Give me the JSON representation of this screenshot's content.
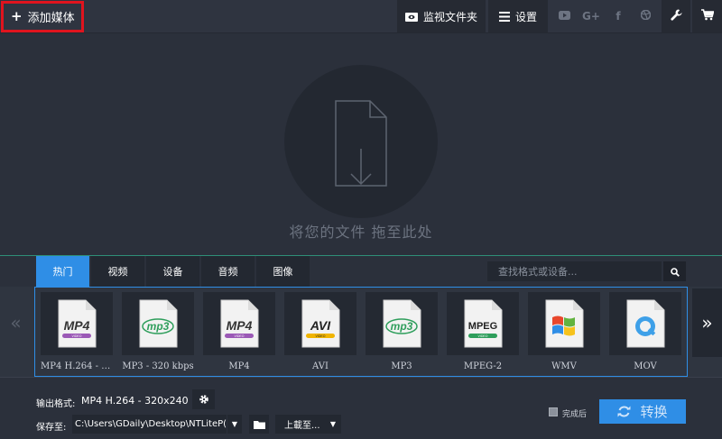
{
  "toolbar": {
    "add_media": "添加媒体",
    "watch_folder": "监视文件夹",
    "settings": "设置",
    "social": [
      "youtube-icon",
      "google-plus-icon",
      "facebook-icon",
      "dribbble-icon"
    ]
  },
  "dropzone": {
    "text": "将您的文件 拖至此处"
  },
  "tabs": [
    {
      "label": "热门",
      "active": true
    },
    {
      "label": "视频",
      "active": false
    },
    {
      "label": "设备",
      "active": false
    },
    {
      "label": "音频",
      "active": false
    },
    {
      "label": "图像",
      "active": false
    }
  ],
  "search": {
    "placeholder": "查找格式或设备..."
  },
  "formats": [
    {
      "label": "MP4 H.264 - 320x240",
      "badge": "MP4",
      "sub": "VIDEO",
      "icon": "mp4-file-icon"
    },
    {
      "label": "MP3 - 320 kbps",
      "badge": "mp3",
      "sub": "",
      "icon": "mp3-file-icon"
    },
    {
      "label": "MP4",
      "badge": "MP4",
      "sub": "VIDEO",
      "icon": "mp4-file-icon"
    },
    {
      "label": "AVI",
      "badge": "AVI",
      "sub": "VIDEO",
      "icon": "avi-file-icon"
    },
    {
      "label": "MP3",
      "badge": "mp3",
      "sub": "",
      "icon": "mp3-file-icon"
    },
    {
      "label": "MPEG-2",
      "badge": "MPEG",
      "sub": "VIDEO",
      "icon": "mpeg-file-icon"
    },
    {
      "label": "WMV",
      "badge": "",
      "sub": "",
      "icon": "windows-logo-icon"
    },
    {
      "label": "MOV",
      "badge": "",
      "sub": "",
      "icon": "quicktime-logo-icon"
    }
  ],
  "nav": {
    "prev": "«",
    "next": "»"
  },
  "output": {
    "label": "输出格式:",
    "value": "MP4 H.264 - 320x240"
  },
  "save": {
    "label": "保存至:",
    "path": "C:\\Users\\GDaily\\Desktop\\NTLiteP(",
    "upload": "上載至..."
  },
  "done": {
    "label": "完成后"
  },
  "convert": {
    "label": "转换"
  },
  "colors": {
    "accent": "#2f8ee6",
    "highlight": "#e0141e",
    "divider": "#2e8f77"
  }
}
